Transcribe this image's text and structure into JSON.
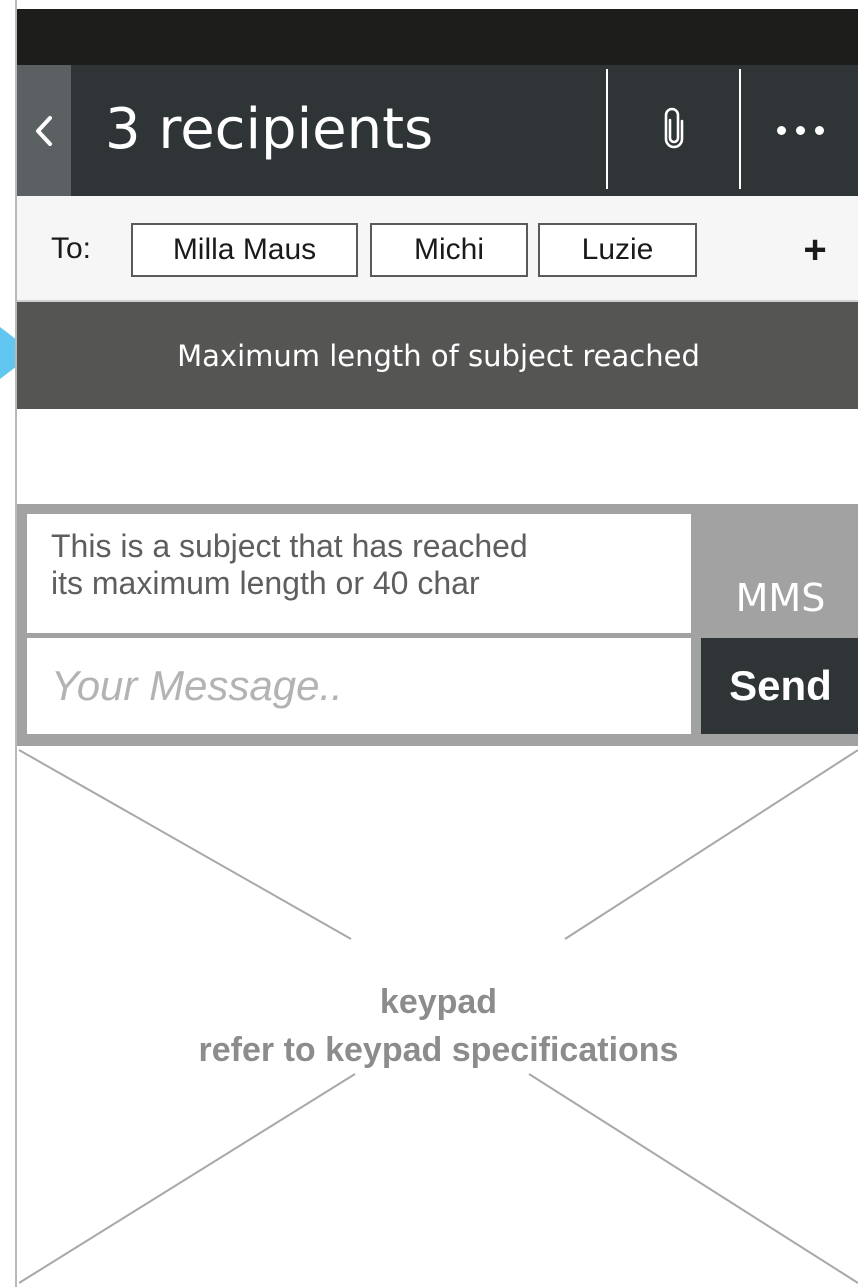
{
  "header": {
    "title": "3 recipients",
    "back_icon": "chevron-left-icon",
    "attach_icon": "paperclip-icon",
    "more_icon": "more-horizontal-icon"
  },
  "recipients": {
    "to_label": "To:",
    "chips": [
      "Milla Maus",
      "Michi",
      "Luzie"
    ],
    "add_label": "+"
  },
  "notice": {
    "text": "Maximum length of subject reached"
  },
  "compose": {
    "subject_line1": "This is a subject that has reached",
    "subject_line2": "its maximum length or 40 char",
    "message_placeholder": "Your Message..",
    "mms_label": "MMS",
    "send_label": "Send"
  },
  "keypad": {
    "line1": "keypad",
    "line2": "refer to keypad specifications"
  },
  "colors": {
    "header_bg": "#2f3436",
    "status_bar": "#1d1d1b",
    "notice_bg": "#555554",
    "compose_bg": "#a2a2a2",
    "pointer": "#62c7f0"
  }
}
